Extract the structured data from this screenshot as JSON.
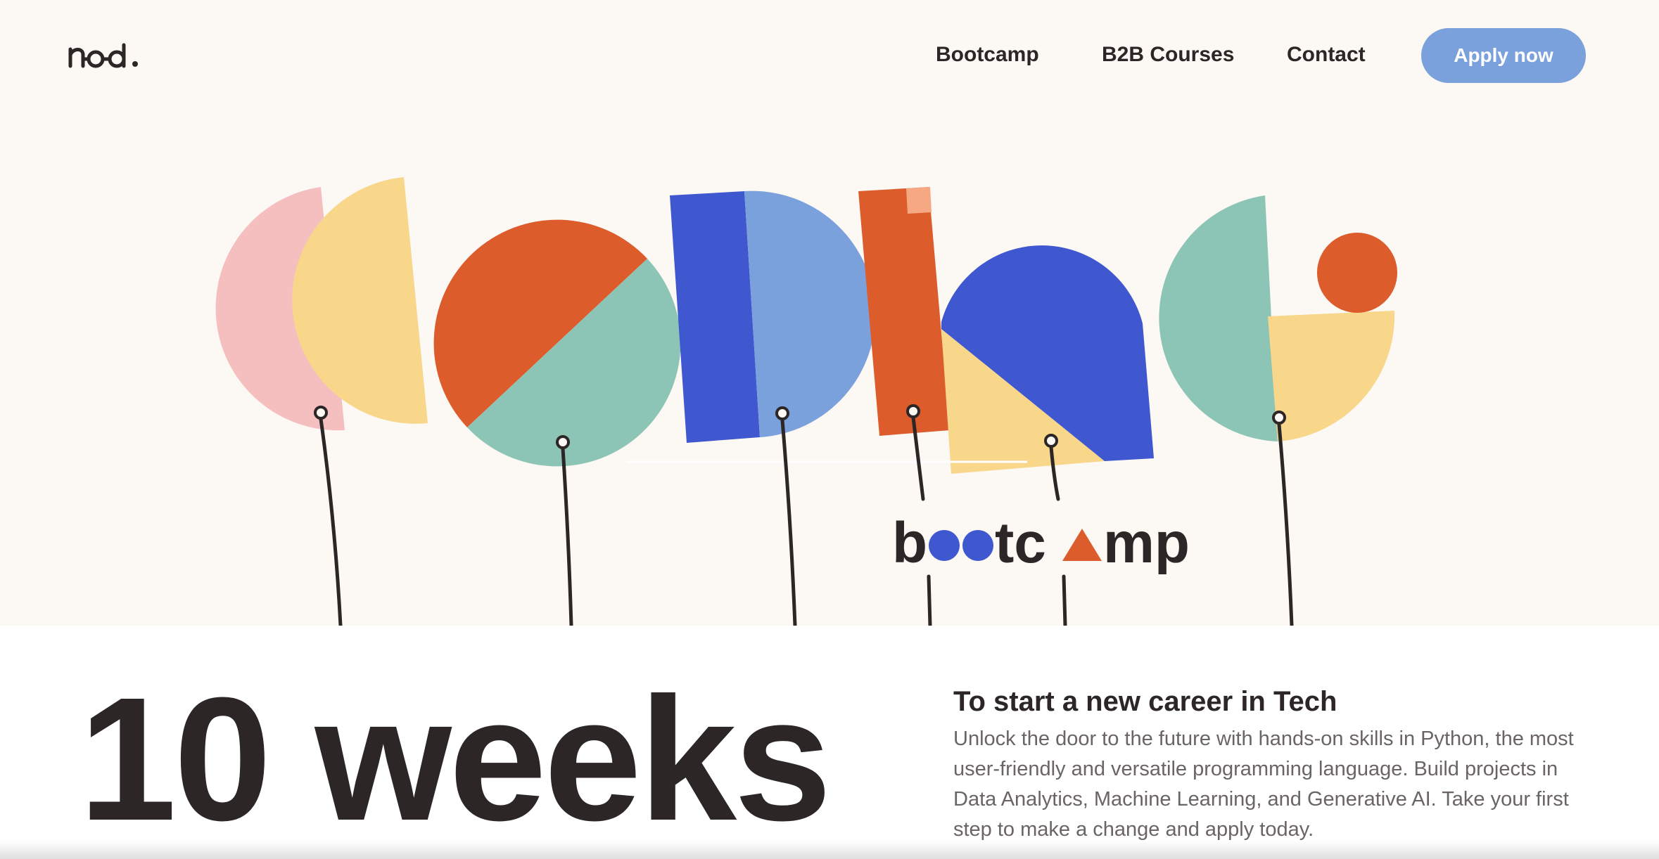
{
  "header": {
    "logo_text": "n-o-d.",
    "nav": {
      "bootcamp": "Bootcamp",
      "b2b_courses": "B2B Courses",
      "contact": "Contact"
    },
    "cta": "Apply now"
  },
  "hero": {
    "art_word": "coding",
    "subtitle_parts": [
      "b",
      "tc",
      "mp"
    ]
  },
  "content": {
    "big_text": "10 weeks",
    "title": "To start a new career in Tech",
    "body": "Unlock the door to the future with hands-on skills in Python, the most user-friendly and versatile programming language. Build projects in Data Analytics, Machine Learning, and Generative AI. Take your first step to make a change and apply today."
  },
  "colors": {
    "background": "#fcf8f3",
    "button": "#7ba1dc",
    "pink": "#f5bfbf",
    "yellow": "#f8d68a",
    "orange": "#dc5c2c",
    "teal": "#8cc5b5",
    "royal_blue": "#3f58cf",
    "light_blue": "#7ba1dc",
    "peach": "#f5a882",
    "text_dark": "#2c2626"
  }
}
